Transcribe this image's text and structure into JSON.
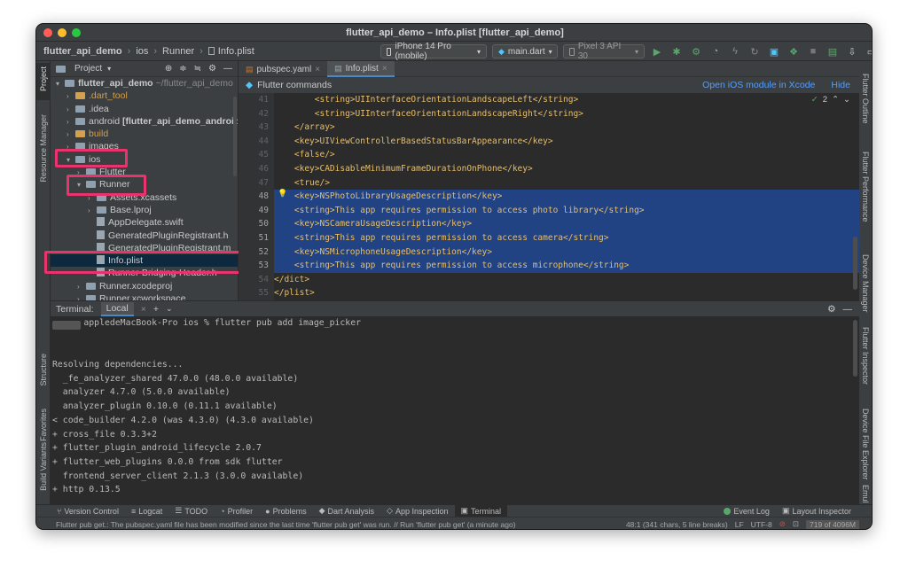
{
  "window": {
    "title": "flutter_api_demo – Info.plist [flutter_api_demo]"
  },
  "toolbar": {
    "breadcrumb": [
      "flutter_api_demo",
      "ios",
      "Runner",
      "Info.plist"
    ],
    "device_selector": "iPhone 14 Pro (mobile)",
    "run_config": "main.dart",
    "emulator": "Pixel 3 API 30"
  },
  "left_stripe": {
    "project": "Project",
    "resource_manager": "Resource Manager",
    "structure": "Structure",
    "favorites": "Favorites",
    "build_variants": "Build Variants"
  },
  "right_stripe": {
    "flutter_outline": "Flutter Outline",
    "flutter_performance": "Flutter Performance",
    "device_manager": "Device Manager",
    "flutter_inspector": "Flutter Inspector",
    "device_file_explorer": "Device File Explorer",
    "emulator": "Emul"
  },
  "project_panel": {
    "title": "Project",
    "tree": [
      {
        "label": "flutter_api_demo",
        "suffix": "~/flutter_api_demo",
        "kind": "folder",
        "depth": 0,
        "open": true
      },
      {
        "label": ".dart_tool",
        "kind": "folder",
        "depth": 1
      },
      {
        "label": ".idea",
        "kind": "folder",
        "depth": 1
      },
      {
        "label": "android",
        "suffix": "[flutter_api_demo_android]",
        "kind": "folder",
        "depth": 1
      },
      {
        "label": "build",
        "kind": "folder",
        "depth": 1
      },
      {
        "label": "images",
        "kind": "folder",
        "depth": 1
      },
      {
        "label": "ios",
        "kind": "folder",
        "depth": 1,
        "open": true
      },
      {
        "label": "Flutter",
        "kind": "folder",
        "depth": 2
      },
      {
        "label": "Runner",
        "kind": "folder",
        "depth": 2,
        "open": true
      },
      {
        "label": "Assets.xcassets",
        "kind": "folder",
        "depth": 3
      },
      {
        "label": "Base.lproj",
        "kind": "folder",
        "depth": 3
      },
      {
        "label": "AppDelegate.swift",
        "kind": "file",
        "depth": 3
      },
      {
        "label": "GeneratedPluginRegistrant.h",
        "kind": "file",
        "depth": 3
      },
      {
        "label": "GeneratedPluginRegistrant.m",
        "kind": "file",
        "depth": 3
      },
      {
        "label": "Info.plist",
        "kind": "file",
        "depth": 3,
        "selected": true
      },
      {
        "label": "Runner-Bridging-Header.h",
        "kind": "file",
        "depth": 3
      },
      {
        "label": "Runner.xcodeproj",
        "kind": "folder",
        "depth": 2
      },
      {
        "label": "Runner.xcworkspace",
        "kind": "folder",
        "depth": 2
      }
    ]
  },
  "editor": {
    "tabs": [
      {
        "label": "pubspec.yaml"
      },
      {
        "label": "Info.plist",
        "active": true
      }
    ],
    "banner": {
      "text": "Flutter commands",
      "open_ios": "Open iOS module in Xcode",
      "hide": "Hide"
    },
    "inspection_count": "2",
    "lines": [
      {
        "n": "41",
        "code": "        <string>UIInterfaceOrientationLandscapeLeft</string>"
      },
      {
        "n": "42",
        "code": "        <string>UIInterfaceOrientationLandscapeRight</string>"
      },
      {
        "n": "43",
        "code": "    </array>"
      },
      {
        "n": "44",
        "code": "    <key>UIViewControllerBasedStatusBarAppearance</key>"
      },
      {
        "n": "45",
        "code": "    <false/>"
      },
      {
        "n": "46",
        "code": "    <key>CADisableMinimumFrameDurationOnPhone</key>"
      },
      {
        "n": "47",
        "code": "    <true/>"
      },
      {
        "n": "48",
        "code": "    <key>NSPhotoLibraryUsageDescription</key>",
        "sel": true
      },
      {
        "n": "49",
        "code": "    <string>This app requires permission to access photo library</string>",
        "sel": true
      },
      {
        "n": "50",
        "code": "    <key>NSCameraUsageDescription</key>",
        "sel": true
      },
      {
        "n": "51",
        "code": "    <string>This app requires permission to access camera</string>",
        "sel": true
      },
      {
        "n": "52",
        "code": "    <key>NSMicrophoneUsageDescription</key>",
        "sel": true
      },
      {
        "n": "53",
        "code": "    <string>This app requires permission to access microphone</string>",
        "sel": true
      },
      {
        "n": "54",
        "code": "</dict>"
      },
      {
        "n": "55",
        "code": "</plist>"
      }
    ]
  },
  "terminal": {
    "label": "Terminal:",
    "tab": "Local",
    "lines": [
      "      appledeMacBook-Pro ios % flutter pub add image_picker",
      "",
      "",
      "Resolving dependencies...",
      "  _fe_analyzer_shared 47.0.0 (48.0.0 available)",
      "  analyzer 4.7.0 (5.0.0 available)",
      "  analyzer_plugin 0.10.0 (0.11.1 available)",
      "< code_builder 4.2.0 (was 4.3.0) (4.3.0 available)",
      "+ cross_file 0.3.3+2",
      "+ flutter_plugin_android_lifecycle 2.0.7",
      "+ flutter_web_plugins 0.0.0 from sdk flutter",
      "  frontend_server_client 2.1.3 (3.0.0 available)",
      "+ http 0.13.5"
    ]
  },
  "bottom_tools": [
    {
      "label": "Version Control"
    },
    {
      "label": "Logcat"
    },
    {
      "label": "TODO"
    },
    {
      "label": "Profiler"
    },
    {
      "label": "Problems"
    },
    {
      "label": "Dart Analysis"
    },
    {
      "label": "App Inspection"
    },
    {
      "label": "Terminal",
      "active": true
    }
  ],
  "bottom_right_tools": [
    {
      "label": "Event Log"
    },
    {
      "label": "Layout Inspector"
    }
  ],
  "status": {
    "message": "Flutter pub get.: The pubspec.yaml file has been modified since the last time 'flutter pub get' was run. // Run 'flutter pub get' (a minute ago)",
    "position": "48:1 (341 chars, 5 line breaks)",
    "line_sep": "LF",
    "encoding": "UTF-8",
    "memory": "719 of 4096M"
  },
  "colors": {
    "highlight": "#e8336d",
    "selection": "#214283",
    "accent": "#4a88c7"
  }
}
